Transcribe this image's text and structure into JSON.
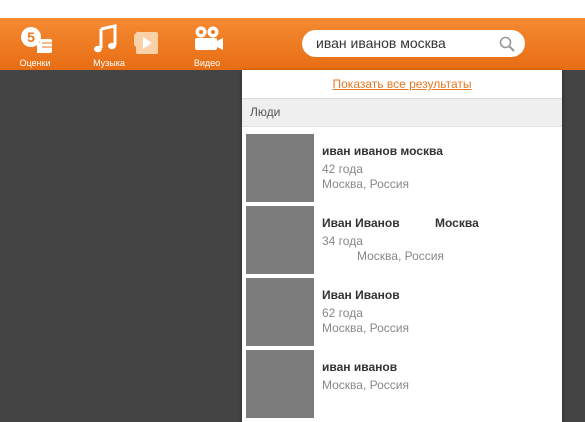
{
  "nav": [
    {
      "id": "grades",
      "label": "Оценки",
      "icon": "thumbs-up-five-icon"
    },
    {
      "id": "music",
      "label": "Музыка",
      "icon": "music-note-icon"
    },
    {
      "id": "video",
      "label": "Видео",
      "icon": "video-camera-icon"
    }
  ],
  "search": {
    "value": "иван иванов москва",
    "icon": "search-icon"
  },
  "dropdown": {
    "show_all": "Показать все результаты",
    "section": "Люди",
    "results": [
      {
        "name": "иван иванов москва",
        "age": "42 года",
        "location": "Москва, Россия"
      },
      {
        "name": "Иван Иванов",
        "name_extra": "Москва",
        "age": "34 года",
        "location": "Москва, Россия"
      },
      {
        "name": "Иван Иванов",
        "age": "62 года",
        "location": "Москва, Россия"
      },
      {
        "name": "иван иванов",
        "location": "Москва, Россия"
      }
    ]
  },
  "colors": {
    "brand_orange": "#ee7a20",
    "link_orange": "#e8761e",
    "background": "#444444"
  }
}
